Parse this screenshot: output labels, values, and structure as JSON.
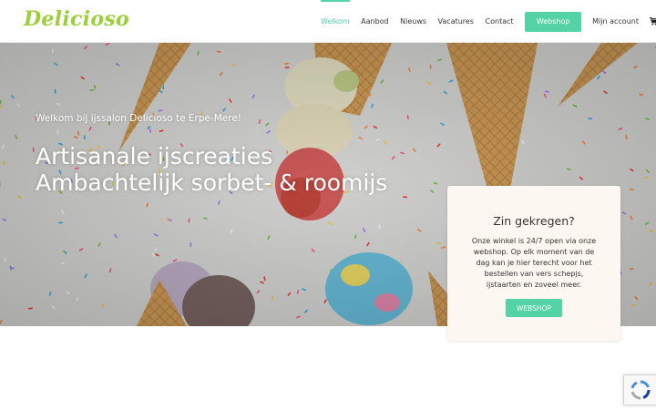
{
  "brand": {
    "logo_text": "Delicioso",
    "accent_color": "#53d3a6",
    "logo_color": "#9ccf3a"
  },
  "nav": {
    "items": [
      {
        "label": "Welkom",
        "active": true
      },
      {
        "label": "Aanbod",
        "active": false
      },
      {
        "label": "Nieuws",
        "active": false
      },
      {
        "label": "Vacatures",
        "active": false
      },
      {
        "label": "Contact",
        "active": false
      }
    ],
    "webshop_label": "Webshop",
    "account_label": "Mijn account",
    "cart_icon": "shopping-cart-icon"
  },
  "hero": {
    "subtitle": "Welkom bij ijssalon Delicioso te Erpe-Mere!",
    "title": "Artisanale ijscreaties Ambachtelijk sorbet- & roomijs"
  },
  "card": {
    "title": "Zin gekregen?",
    "text": "Onze winkel is 24/7 open via onze webshop. Op elk moment van de dag kan je hier terecht voor het bestellen van vers schepjs, ijstaarten en zoveel meer.",
    "button_label": "WEBSHOP"
  },
  "recaptcha": {
    "icon": "recaptcha-icon"
  }
}
